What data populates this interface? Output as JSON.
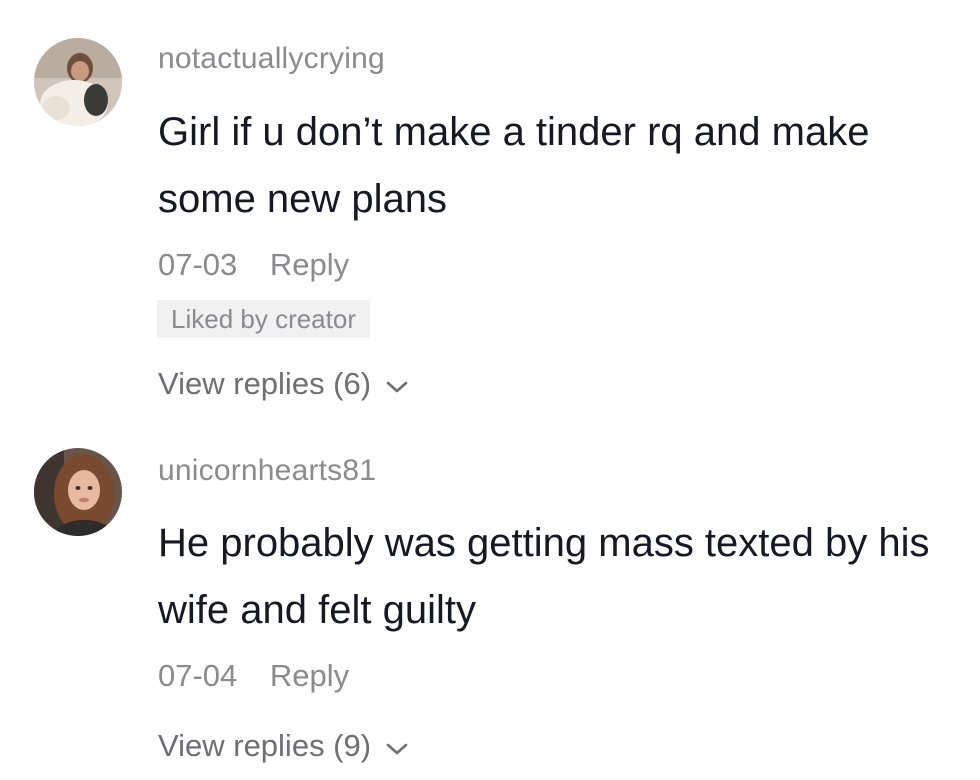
{
  "comments": [
    {
      "username": "notactuallycrying",
      "text": "Girl if u don’t make a tinder rq and make some new plans",
      "date": "07-03",
      "reply_label": "Reply",
      "badge": "Liked by creator",
      "view_replies_label": "View replies (6)",
      "avatar_icon": "user-avatar-photo"
    },
    {
      "username": "unicornhearts81",
      "text": "He probably was getting mass texted by his wife and felt guilty",
      "date": "07-04",
      "reply_label": "Reply",
      "view_replies_label": "View replies (9)",
      "avatar_icon": "user-avatar-photo"
    }
  ],
  "colors": {
    "text_primary": "#161823",
    "text_secondary": "#8a8a8f",
    "badge_bg": "#f1f1f2"
  },
  "icons": {
    "expand": "chevron-down-icon"
  }
}
